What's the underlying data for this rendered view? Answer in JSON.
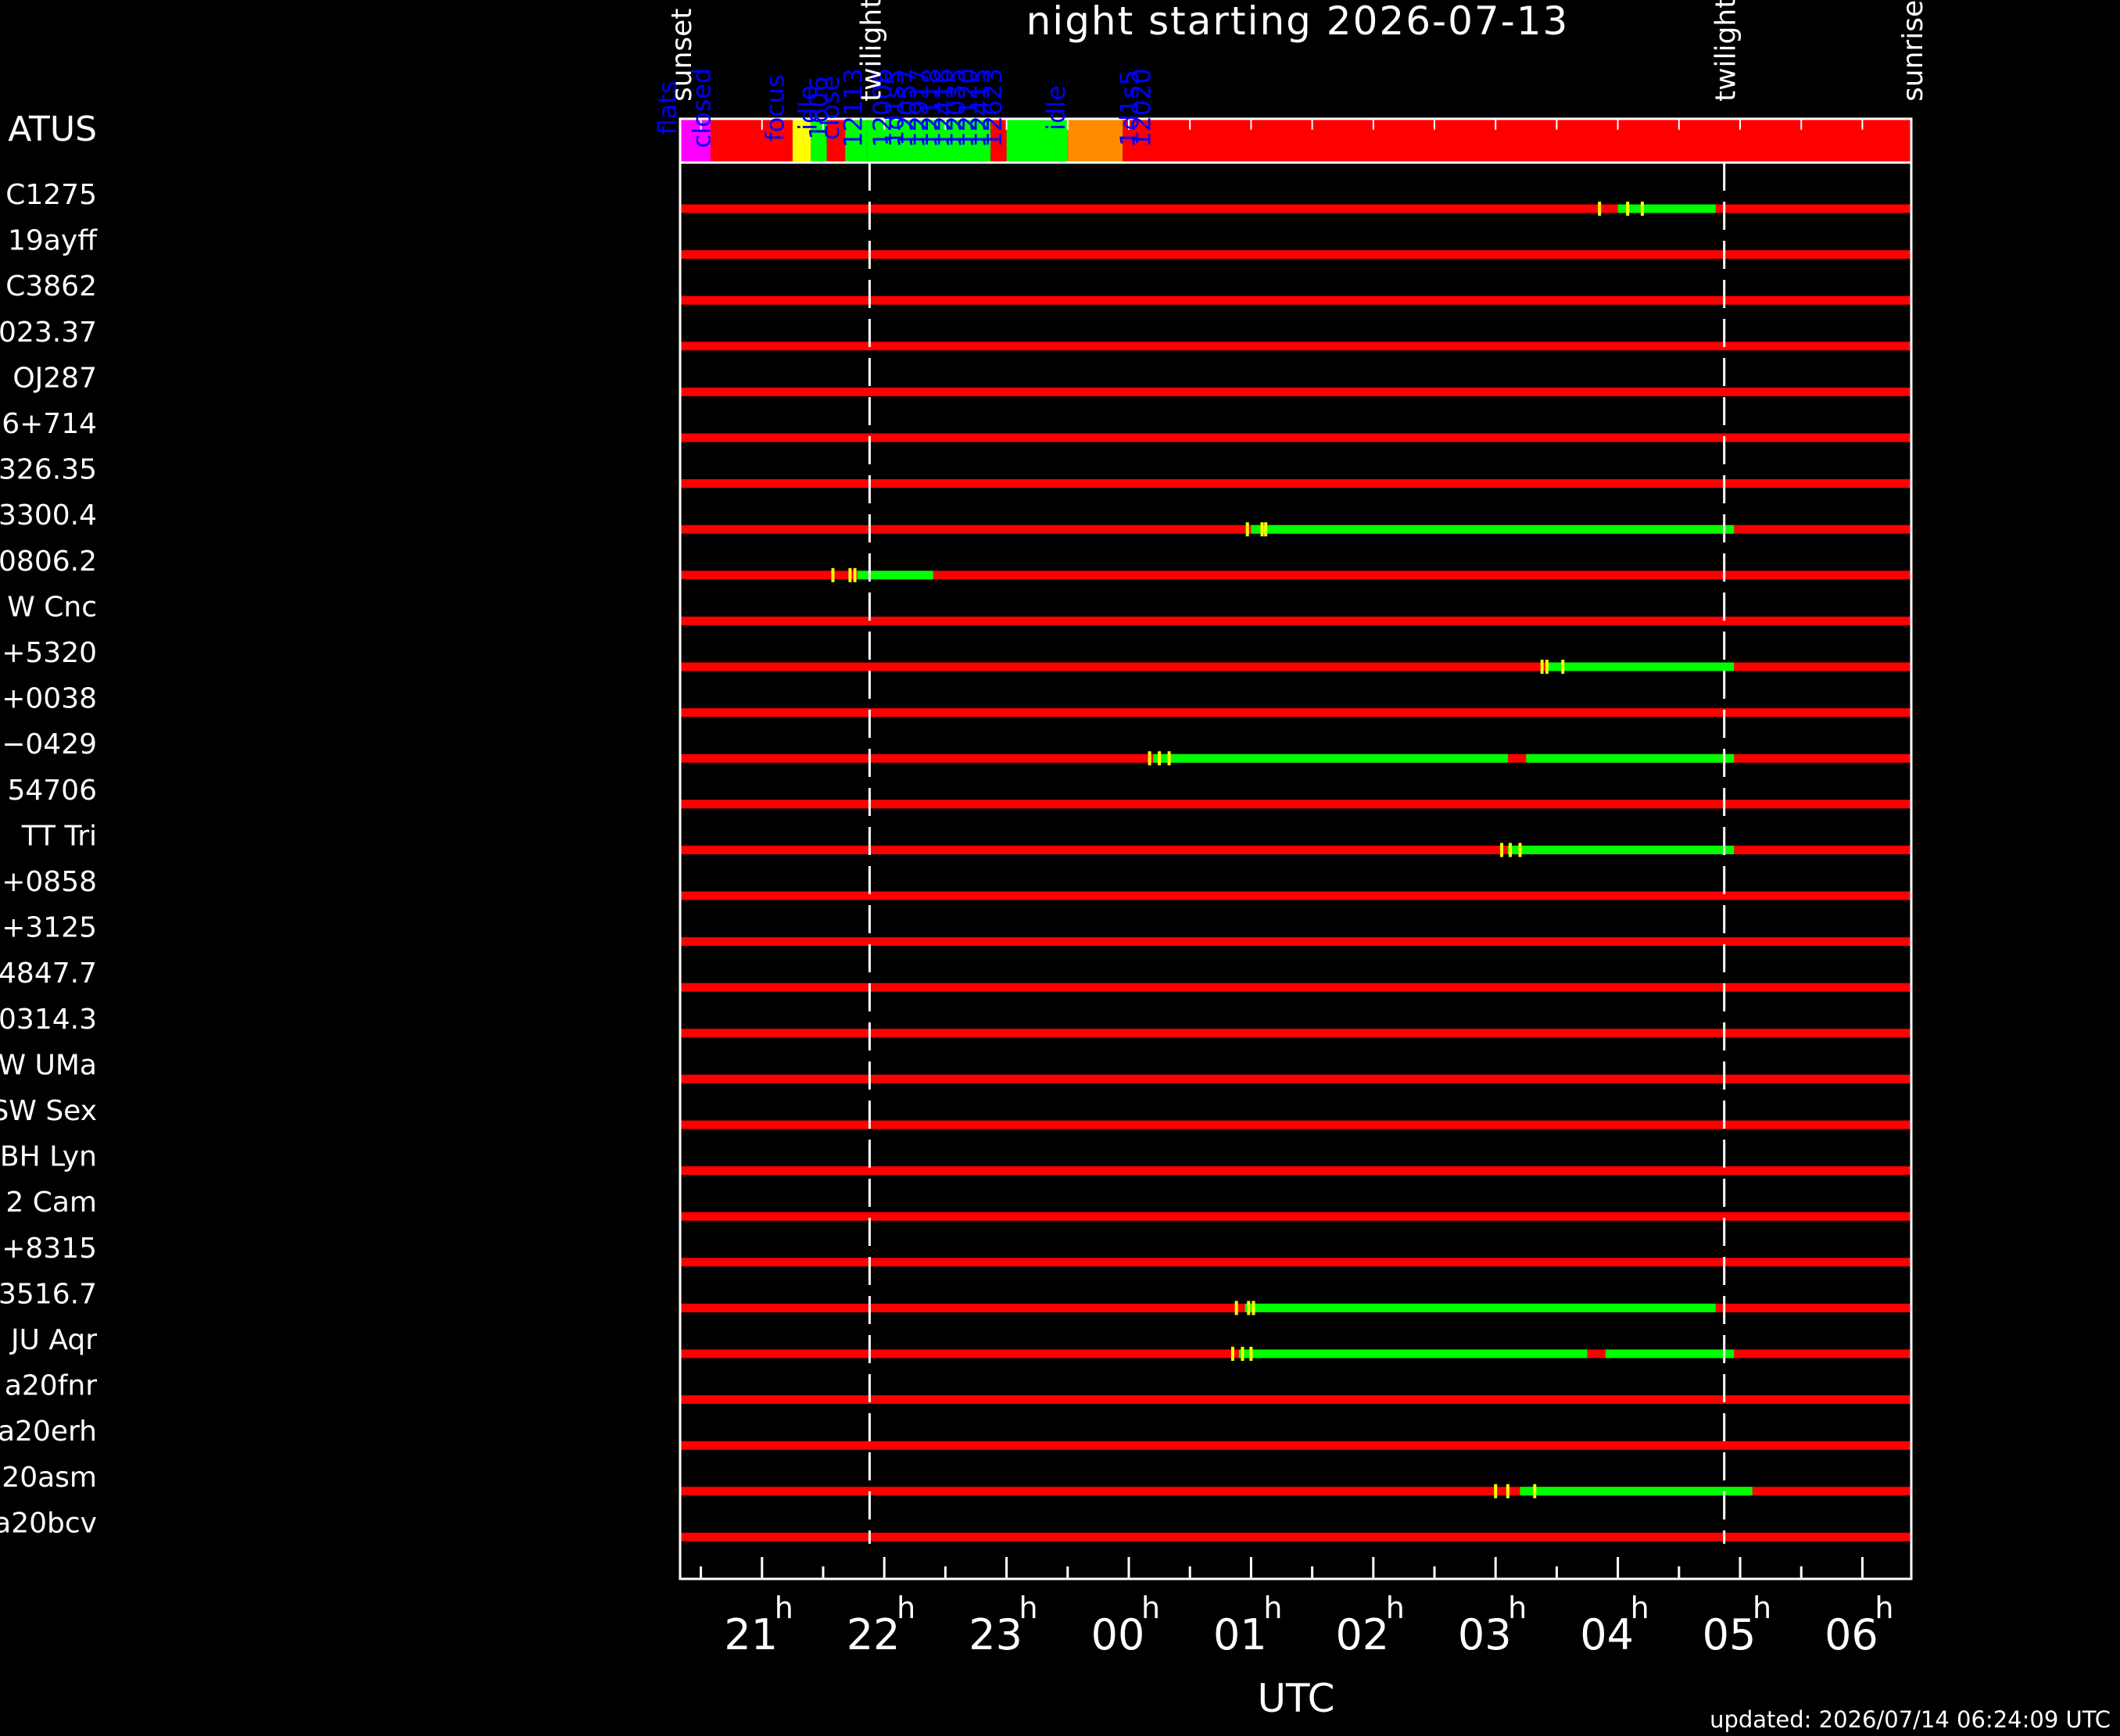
{
  "chart_data": {
    "type": "timeline",
    "title": "night starting 2026-07-13",
    "xlabel": "UTC",
    "updated": "updated: 2026/07/14 06:24:09 UTC",
    "status_label": "ATUS",
    "x_range_hours": [
      20.33,
      30.4
    ],
    "x_ticks": [
      {
        "h": 21,
        "label": "21"
      },
      {
        "h": 22,
        "label": "22"
      },
      {
        "h": 23,
        "label": "23"
      },
      {
        "h": 24,
        "label": "00"
      },
      {
        "h": 25,
        "label": "01"
      },
      {
        "h": 26,
        "label": "02"
      },
      {
        "h": 27,
        "label": "03"
      },
      {
        "h": 28,
        "label": "04"
      },
      {
        "h": 29,
        "label": "05"
      },
      {
        "h": 30,
        "label": "06"
      }
    ],
    "hour_superscript": "h",
    "events": [
      {
        "label": "sunset",
        "h": 20.33
      },
      {
        "label": "twilight",
        "h": 21.88
      },
      {
        "label": "twilight",
        "h": 28.87
      },
      {
        "label": "sunrise",
        "h": 30.4
      }
    ],
    "dashed_lines_h": [
      21.88,
      28.87
    ],
    "status_segments": [
      {
        "from": 20.33,
        "to": 20.58,
        "color": "#ff00ff"
      },
      {
        "from": 20.58,
        "to": 21.25,
        "color": "#ff0000"
      },
      {
        "from": 21.25,
        "to": 21.4,
        "color": "#ffff00"
      },
      {
        "from": 21.4,
        "to": 21.53,
        "color": "#00ff00"
      },
      {
        "from": 21.53,
        "to": 21.68,
        "color": "#ff0000"
      },
      {
        "from": 21.68,
        "to": 21.86,
        "color": "#00ff00"
      },
      {
        "from": 21.86,
        "to": 22.87,
        "color": "#00ff00"
      },
      {
        "from": 22.87,
        "to": 23.0,
        "color": "#ff0000"
      },
      {
        "from": 23.0,
        "to": 23.5,
        "color": "#00ff00"
      },
      {
        "from": 23.5,
        "to": 23.95,
        "color": "#ff8c00"
      },
      {
        "from": 23.95,
        "to": 30.4,
        "color": "#ff0000"
      }
    ],
    "status_labels": [
      {
        "text": "flats",
        "h": 20.22
      },
      {
        "text": "closed",
        "h": 20.5
      },
      {
        "text": "focus",
        "h": 21.1
      },
      {
        "text": "idle",
        "h": 21.37
      },
      {
        "text": "1606",
        "h": 21.46
      },
      {
        "text": "close",
        "h": 21.55
      },
      {
        "text": "12113",
        "h": 21.74
      },
      {
        "text": "12006",
        "h": 21.98
      },
      {
        "text": "1d1s5",
        "h": 22.08
      },
      {
        "text": "12057",
        "h": 22.18
      },
      {
        "text": "12917",
        "h": 22.28
      },
      {
        "text": "12118",
        "h": 22.38
      },
      {
        "text": "12416",
        "h": 22.48
      },
      {
        "text": "12035",
        "h": 22.58
      },
      {
        "text": "12120",
        "h": 22.68
      },
      {
        "text": "12415",
        "h": 22.78
      },
      {
        "text": "12623",
        "h": 22.88
      },
      {
        "text": "idle",
        "h": 23.4
      },
      {
        "text": "1d1s5",
        "h": 24.0
      },
      {
        "text": "12020",
        "h": 24.1
      }
    ],
    "targets": [
      {
        "label": "C1275",
        "bars": [
          {
            "from": 28.0,
            "to": 28.8
          }
        ],
        "marks": [
          27.85,
          28.08,
          28.2
        ]
      },
      {
        "label": "19ayff",
        "bars": [],
        "marks": []
      },
      {
        "label": "C3862",
        "bars": [],
        "marks": []
      },
      {
        "label": "023.37",
        "bars": [],
        "marks": []
      },
      {
        "label": "OJ287",
        "bars": [],
        "marks": []
      },
      {
        "label": "6+714",
        "bars": [],
        "marks": []
      },
      {
        "label": "326.35",
        "bars": [],
        "marks": []
      },
      {
        "label": "3300.4",
        "bars": [
          {
            "from": 25.0,
            "to": 28.95
          }
        ],
        "marks": [
          24.97,
          25.09,
          25.12
        ]
      },
      {
        "label": "0806.2",
        "bars": [
          {
            "from": 21.78,
            "to": 22.4
          }
        ],
        "marks": [
          21.58,
          21.72,
          21.76
        ]
      },
      {
        "label": "W Cnc",
        "bars": [],
        "marks": []
      },
      {
        "label": "+5320",
        "bars": [
          {
            "from": 27.42,
            "to": 28.95
          }
        ],
        "marks": [
          27.38,
          27.42,
          27.55
        ]
      },
      {
        "label": "+0038",
        "bars": [],
        "marks": []
      },
      {
        "label": "−0429",
        "bars": [
          {
            "from": 24.2,
            "to": 27.1
          },
          {
            "from": 27.25,
            "to": 28.95
          }
        ],
        "marks": [
          24.17,
          24.25,
          24.33
        ]
      },
      {
        "label": "54706",
        "bars": [],
        "marks": []
      },
      {
        "label": "TT Tri",
        "bars": [
          {
            "from": 27.1,
            "to": 28.95
          }
        ],
        "marks": [
          27.05,
          27.12,
          27.2
        ]
      },
      {
        "label": "+0858",
        "bars": [],
        "marks": []
      },
      {
        "label": "+3125",
        "bars": [],
        "marks": []
      },
      {
        "label": "4847.7",
        "bars": [],
        "marks": []
      },
      {
        "label": "0314.3",
        "bars": [],
        "marks": []
      },
      {
        "label": "W UMa",
        "bars": [],
        "marks": []
      },
      {
        "label": "SW Sex",
        "bars": [],
        "marks": []
      },
      {
        "label": "BH Lyn",
        "bars": [],
        "marks": []
      },
      {
        "label": "2 Cam",
        "bars": [],
        "marks": []
      },
      {
        "label": "+8315",
        "bars": [],
        "marks": []
      },
      {
        "label": "3516.7",
        "bars": [
          {
            "from": 24.95,
            "to": 28.8
          }
        ],
        "marks": [
          24.88,
          24.98,
          25.02
        ]
      },
      {
        "label": "JU Aqr",
        "bars": [
          {
            "from": 24.9,
            "to": 27.75
          },
          {
            "from": 27.9,
            "to": 28.95
          }
        ],
        "marks": [
          24.85,
          24.93,
          25.0
        ]
      },
      {
        "label": "a20fnr",
        "bars": [],
        "marks": []
      },
      {
        "label": "a20erh",
        "bars": [],
        "marks": []
      },
      {
        "label": "20asm",
        "bars": [
          {
            "from": 27.2,
            "to": 29.1
          }
        ],
        "marks": [
          27.0,
          27.1,
          27.32
        ]
      },
      {
        "label": "a20bcv",
        "bars": [],
        "marks": []
      }
    ],
    "colors": {
      "background": "#000000",
      "axis": "#ffffff",
      "unobserved": "#ff0000",
      "observed": "#00ff00",
      "mark": "#ffff00",
      "status_text": "#0000ff"
    }
  }
}
